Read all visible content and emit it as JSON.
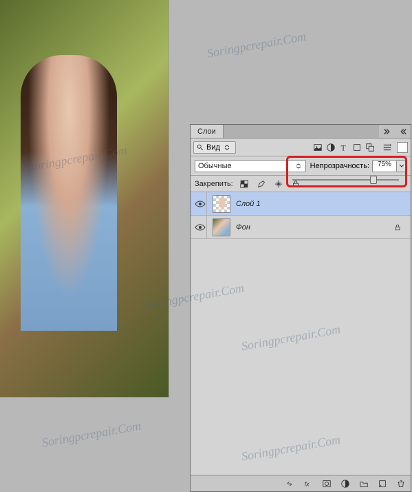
{
  "panel": {
    "tab_label": "Слои",
    "view_label": "Вид",
    "blend_mode": "Обычные",
    "opacity_label": "Непрозрачность:",
    "opacity_value": "75%",
    "lock_label": "Закрепить:",
    "layers": [
      {
        "name": "Слой 1",
        "selected": true,
        "locked": false
      },
      {
        "name": "Фон",
        "selected": false,
        "locked": true
      }
    ]
  },
  "watermark_text": "Soringpcrepair.Com",
  "colors": {
    "highlight": "#d62020",
    "selected_layer": "#b8ccf0",
    "panel_bg": "#d4d4d4"
  }
}
